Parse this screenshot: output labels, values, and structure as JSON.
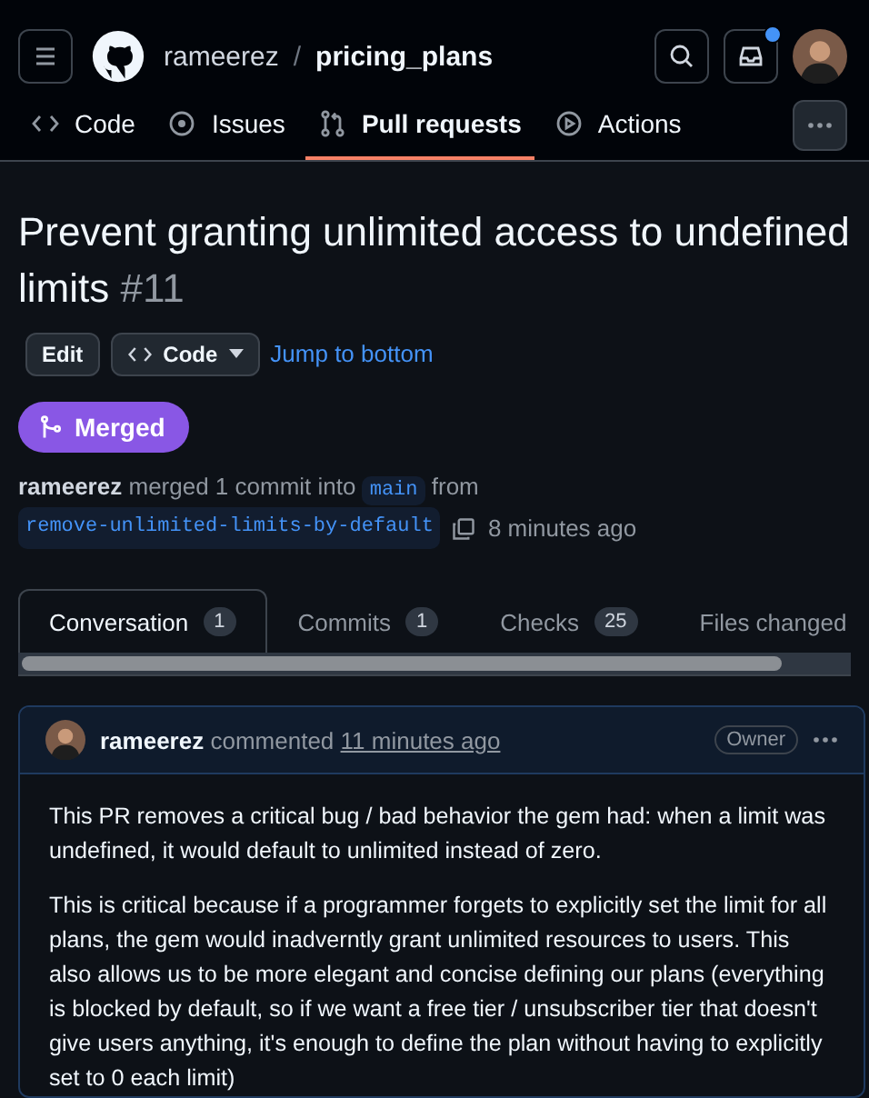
{
  "header": {
    "owner": "rameerez",
    "separator": "/",
    "repo": "pricing_plans",
    "unread_notifications": true
  },
  "nav": [
    {
      "label": "Code",
      "selected": false
    },
    {
      "label": "Issues",
      "selected": false
    },
    {
      "label": "Pull requests",
      "selected": true
    },
    {
      "label": "Actions",
      "selected": false
    }
  ],
  "title": {
    "text": "Prevent granting unlimited access to undefined limits",
    "number": "#11"
  },
  "actions": {
    "edit": "Edit",
    "code": "Code",
    "jump": "Jump to bottom"
  },
  "status": {
    "label": "Merged"
  },
  "merge_info": {
    "author": "rameerez",
    "text": "merged 1 commit into",
    "base": "main",
    "from": "from",
    "head": "remove-unlimited-limits-by-default",
    "time": "8 minutes ago"
  },
  "pr_tabs": [
    {
      "label": "Conversation",
      "count": "1",
      "selected": true
    },
    {
      "label": "Commits",
      "count": "1",
      "selected": false
    },
    {
      "label": "Checks",
      "count": "25",
      "selected": false
    },
    {
      "label": "Files changed",
      "selected": false
    }
  ],
  "comment": {
    "author": "rameerez",
    "action": "commented",
    "time": "11 minutes ago",
    "role": "Owner",
    "paragraphs": [
      "This PR removes a critical bug / bad behavior the gem had: when a limit was undefined, it would default to unlimited instead of zero.",
      "This is critical because if a programmer forgets to explicitly set the limit for all plans, the gem would inadverntly grant unlimited resources to users. This also allows us to be more elegant and concise defining our plans (everything is blocked by default, so if we want a free tier / unsubscriber tier that doesn't give users anything, it's enough to define the plan without having to explicitly set to 0 each limit)"
    ]
  }
}
